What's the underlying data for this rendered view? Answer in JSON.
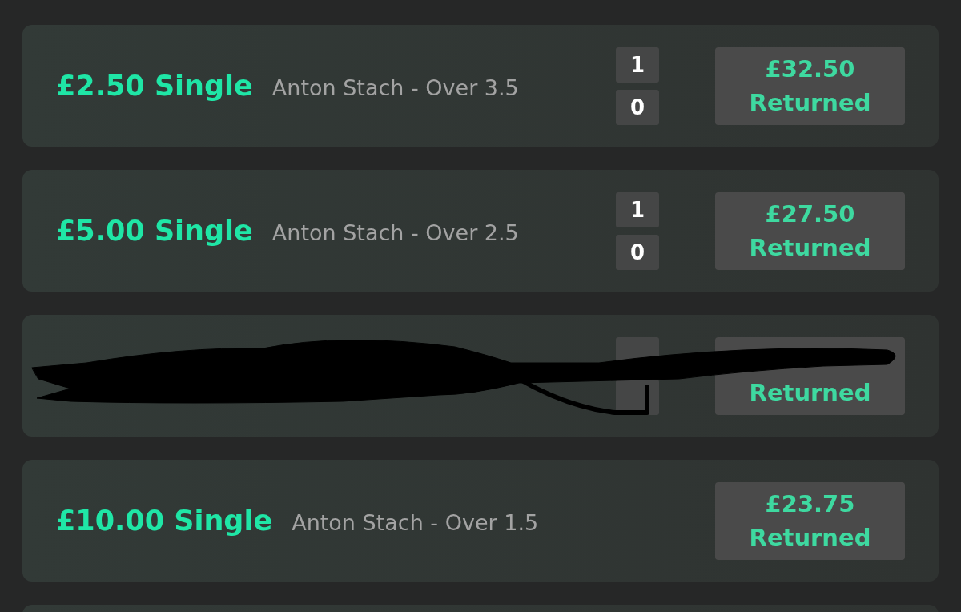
{
  "bets": [
    {
      "kind": "bet",
      "stake": "£2.50 Single",
      "selection": "Anton Stach - Over 3.5",
      "scores": [
        "1",
        "0"
      ],
      "amount": "£32.50",
      "status": "Returned"
    },
    {
      "kind": "bet",
      "stake": "£5.00 Single",
      "selection": "Anton Stach - Over 2.5",
      "scores": [
        "1",
        "0"
      ],
      "amount": "£27.50",
      "status": "Returned"
    },
    {
      "kind": "scribbled",
      "status": "Returned"
    },
    {
      "kind": "bet",
      "stake": "£10.00 Single",
      "selection": "Anton Stach - Over 1.5",
      "amount": "£23.75",
      "status": "Returned"
    }
  ]
}
